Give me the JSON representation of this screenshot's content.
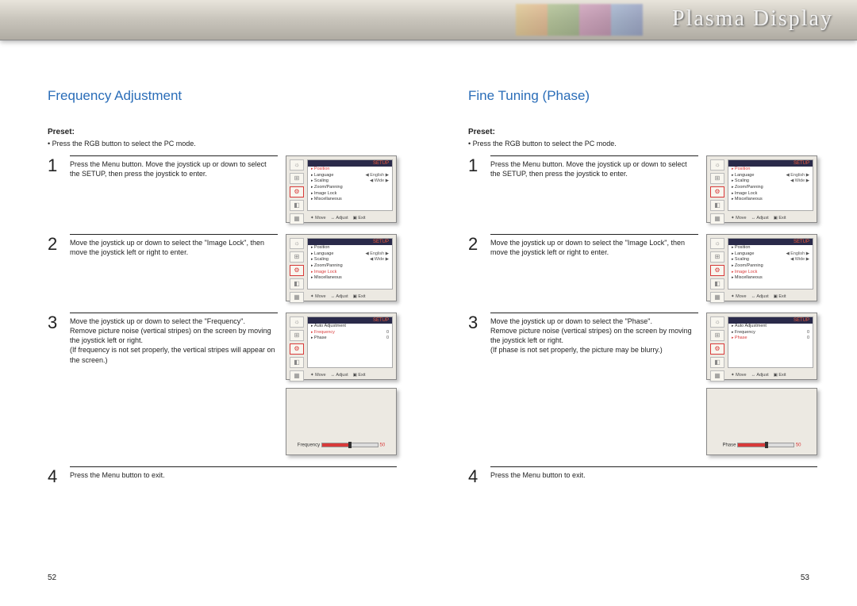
{
  "header": {
    "title": "Plasma Display"
  },
  "left": {
    "title": "Frequency Adjustment",
    "preset_label": "Preset:",
    "preset_text": "Press the RGB button to select the PC mode.",
    "steps": [
      {
        "num": "1",
        "text": "Press the Menu button. Move the joystick up or down to select the SETUP, then press the joystick to enter."
      },
      {
        "num": "2",
        "text": "Move the joystick up or down to select the \"Image Lock\", then move the joystick left or right to enter."
      },
      {
        "num": "3",
        "text": "Move the joystick up or down to select the \"Frequency\".\nRemove picture noise (vertical stripes) on the screen by moving the joystick left or right.\n(If frequency is not set properly, the vertical stripes will appear on the screen.)"
      },
      {
        "num": "4",
        "text": "Press the Menu button to exit."
      }
    ],
    "page_num": "52",
    "scr1": {
      "header": "SETUP",
      "rows": [
        {
          "label": "Position",
          "hl": true
        },
        {
          "label": "Language",
          "val": "◀ English ▶"
        },
        {
          "label": "Scaling",
          "val": "◀ Wide ▶"
        },
        {
          "label": "Zoom/Panning"
        },
        {
          "label": "Image Lock"
        },
        {
          "label": "Miscellaneous"
        }
      ],
      "footer": [
        "✦ Move",
        "↔ Adjust",
        "▣ Exit"
      ]
    },
    "scr2": {
      "header": "SETUP",
      "rows": [
        {
          "label": "Position"
        },
        {
          "label": "Language",
          "val": "◀ English ▶"
        },
        {
          "label": "Scaling",
          "val": "◀ Wide ▶"
        },
        {
          "label": "Zoom/Panning"
        },
        {
          "label": "Image Lock",
          "hl": true
        },
        {
          "label": "Miscellaneous"
        }
      ],
      "footer": [
        "✦ Move",
        "↔ Adjust",
        "▣ Exit"
      ]
    },
    "scr3": {
      "header": "SETUP",
      "rows": [
        {
          "label": "Auto Adjustment"
        },
        {
          "label": "Frequency",
          "hl": true,
          "val": "0"
        },
        {
          "label": "Phase",
          "val": "0"
        }
      ],
      "footer": [
        "✦ Move",
        "↔ Adjust",
        "▣ Exit"
      ]
    },
    "slider": {
      "label": "Frequency",
      "value": "50"
    }
  },
  "right": {
    "title": "Fine Tuning (Phase)",
    "preset_label": "Preset:",
    "preset_text": "Press the RGB button to select the PC mode.",
    "steps": [
      {
        "num": "1",
        "text": "Press the Menu button. Move the joystick up or down to select the SETUP, then press the joystick to enter."
      },
      {
        "num": "2",
        "text": "Move the joystick up or down to select the \"Image Lock\", then move the joystick left or right to enter."
      },
      {
        "num": "3",
        "text": "Move the joystick up or down to select the \"Phase\".\nRemove picture noise (vertical stripes) on the screen by moving the joystick left or right.\n(If phase is not set properly, the picture may be blurry.)"
      },
      {
        "num": "4",
        "text": "Press the Menu button to exit."
      }
    ],
    "page_num": "53",
    "scr1": {
      "header": "SETUP",
      "rows": [
        {
          "label": "Position",
          "hl": true
        },
        {
          "label": "Language",
          "val": "◀ English ▶"
        },
        {
          "label": "Scaling",
          "val": "◀ Wide ▶"
        },
        {
          "label": "Zoom/Panning"
        },
        {
          "label": "Image Lock"
        },
        {
          "label": "Miscellaneous"
        }
      ],
      "footer": [
        "✦ Move",
        "↔ Adjust",
        "▣ Exit"
      ]
    },
    "scr2": {
      "header": "SETUP",
      "rows": [
        {
          "label": "Position"
        },
        {
          "label": "Language",
          "val": "◀ English ▶"
        },
        {
          "label": "Scaling",
          "val": "◀ Wide ▶"
        },
        {
          "label": "Zoom/Panning"
        },
        {
          "label": "Image Lock",
          "hl": true
        },
        {
          "label": "Miscellaneous"
        }
      ],
      "footer": [
        "✦ Move",
        "↔ Adjust",
        "▣ Exit"
      ]
    },
    "scr3": {
      "header": "SETUP",
      "rows": [
        {
          "label": "Auto Adjustment"
        },
        {
          "label": "Frequency",
          "val": "0"
        },
        {
          "label": "Phase",
          "hl": true,
          "val": "0"
        }
      ],
      "footer": [
        "✦ Move",
        "↔ Adjust",
        "▣ Exit"
      ]
    },
    "slider": {
      "label": "Phase",
      "value": "50"
    }
  }
}
